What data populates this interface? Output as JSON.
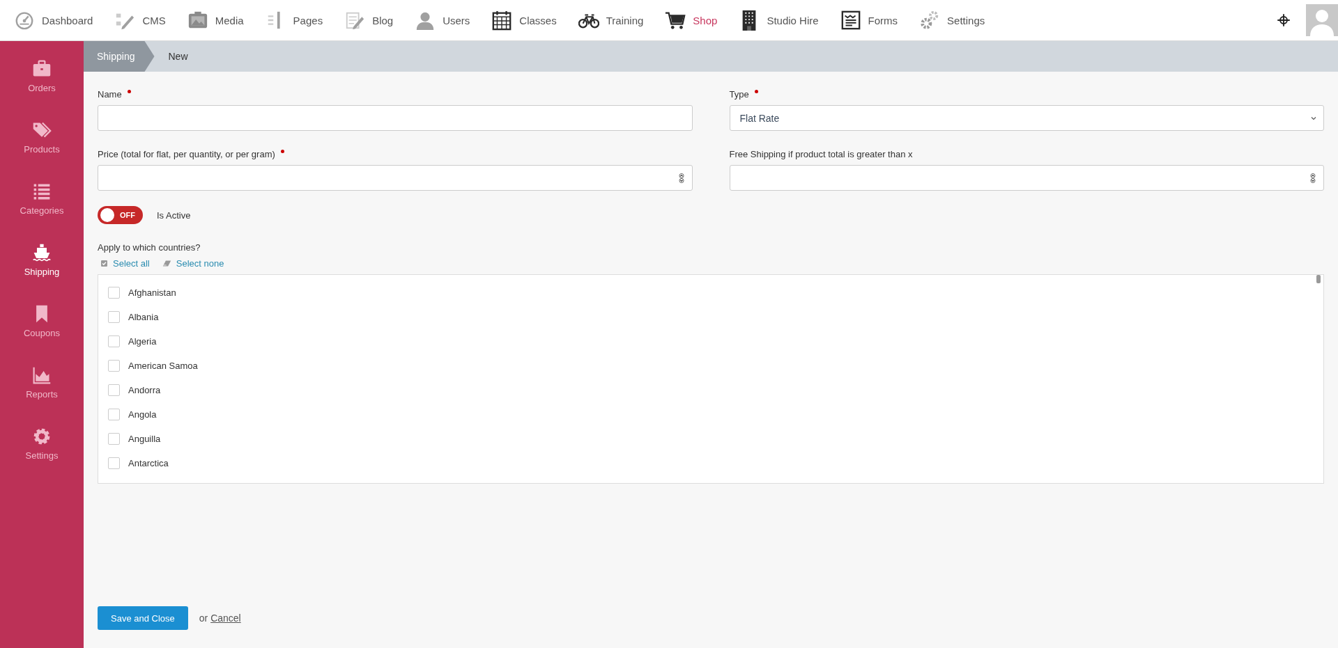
{
  "top_nav": {
    "items": [
      {
        "label": "Dashboard",
        "selected": false
      },
      {
        "label": "CMS",
        "selected": false
      },
      {
        "label": "Media",
        "selected": false
      },
      {
        "label": "Pages",
        "selected": false
      },
      {
        "label": "Blog",
        "selected": false
      },
      {
        "label": "Users",
        "selected": false
      },
      {
        "label": "Classes",
        "selected": false
      },
      {
        "label": "Training",
        "selected": false
      },
      {
        "label": "Shop",
        "selected": true
      },
      {
        "label": "Studio Hire",
        "selected": false
      },
      {
        "label": "Forms",
        "selected": false
      },
      {
        "label": "Settings",
        "selected": false
      }
    ]
  },
  "sidebar": {
    "items": [
      {
        "label": "Orders",
        "selected": false
      },
      {
        "label": "Products",
        "selected": false
      },
      {
        "label": "Categories",
        "selected": false
      },
      {
        "label": "Shipping",
        "selected": true
      },
      {
        "label": "Coupons",
        "selected": false
      },
      {
        "label": "Reports",
        "selected": false
      },
      {
        "label": "Settings",
        "selected": false
      }
    ]
  },
  "breadcrumb": [
    "Shipping",
    "New"
  ],
  "form": {
    "fields": [
      {
        "kind": "text",
        "label": "Name",
        "required": true
      },
      {
        "kind": "select",
        "label": "Type",
        "required": true,
        "value": "Flat Rate"
      },
      {
        "kind": "number",
        "label": "Price (total for flat, per quantity, or per gram)",
        "required": true
      },
      {
        "kind": "number",
        "label": "Free Shipping if product total is greater than x",
        "required": false
      }
    ],
    "active": {
      "label": "Is Active",
      "on": false,
      "state_text": "OFF"
    },
    "countries": {
      "label": "Apply to which countries?",
      "select_all": "Select all",
      "select_none": "Select none",
      "items": [
        {
          "name": "Afghanistan",
          "checked": false
        },
        {
          "name": "Albania",
          "checked": false
        },
        {
          "name": "Algeria",
          "checked": false
        },
        {
          "name": "American Samoa",
          "checked": false
        },
        {
          "name": "Andorra",
          "checked": false
        },
        {
          "name": "Angola",
          "checked": false
        },
        {
          "name": "Anguilla",
          "checked": false
        },
        {
          "name": "Antarctica",
          "checked": false
        }
      ]
    },
    "actions": {
      "save": "Save and Close",
      "or": "or",
      "cancel": "Cancel"
    }
  }
}
